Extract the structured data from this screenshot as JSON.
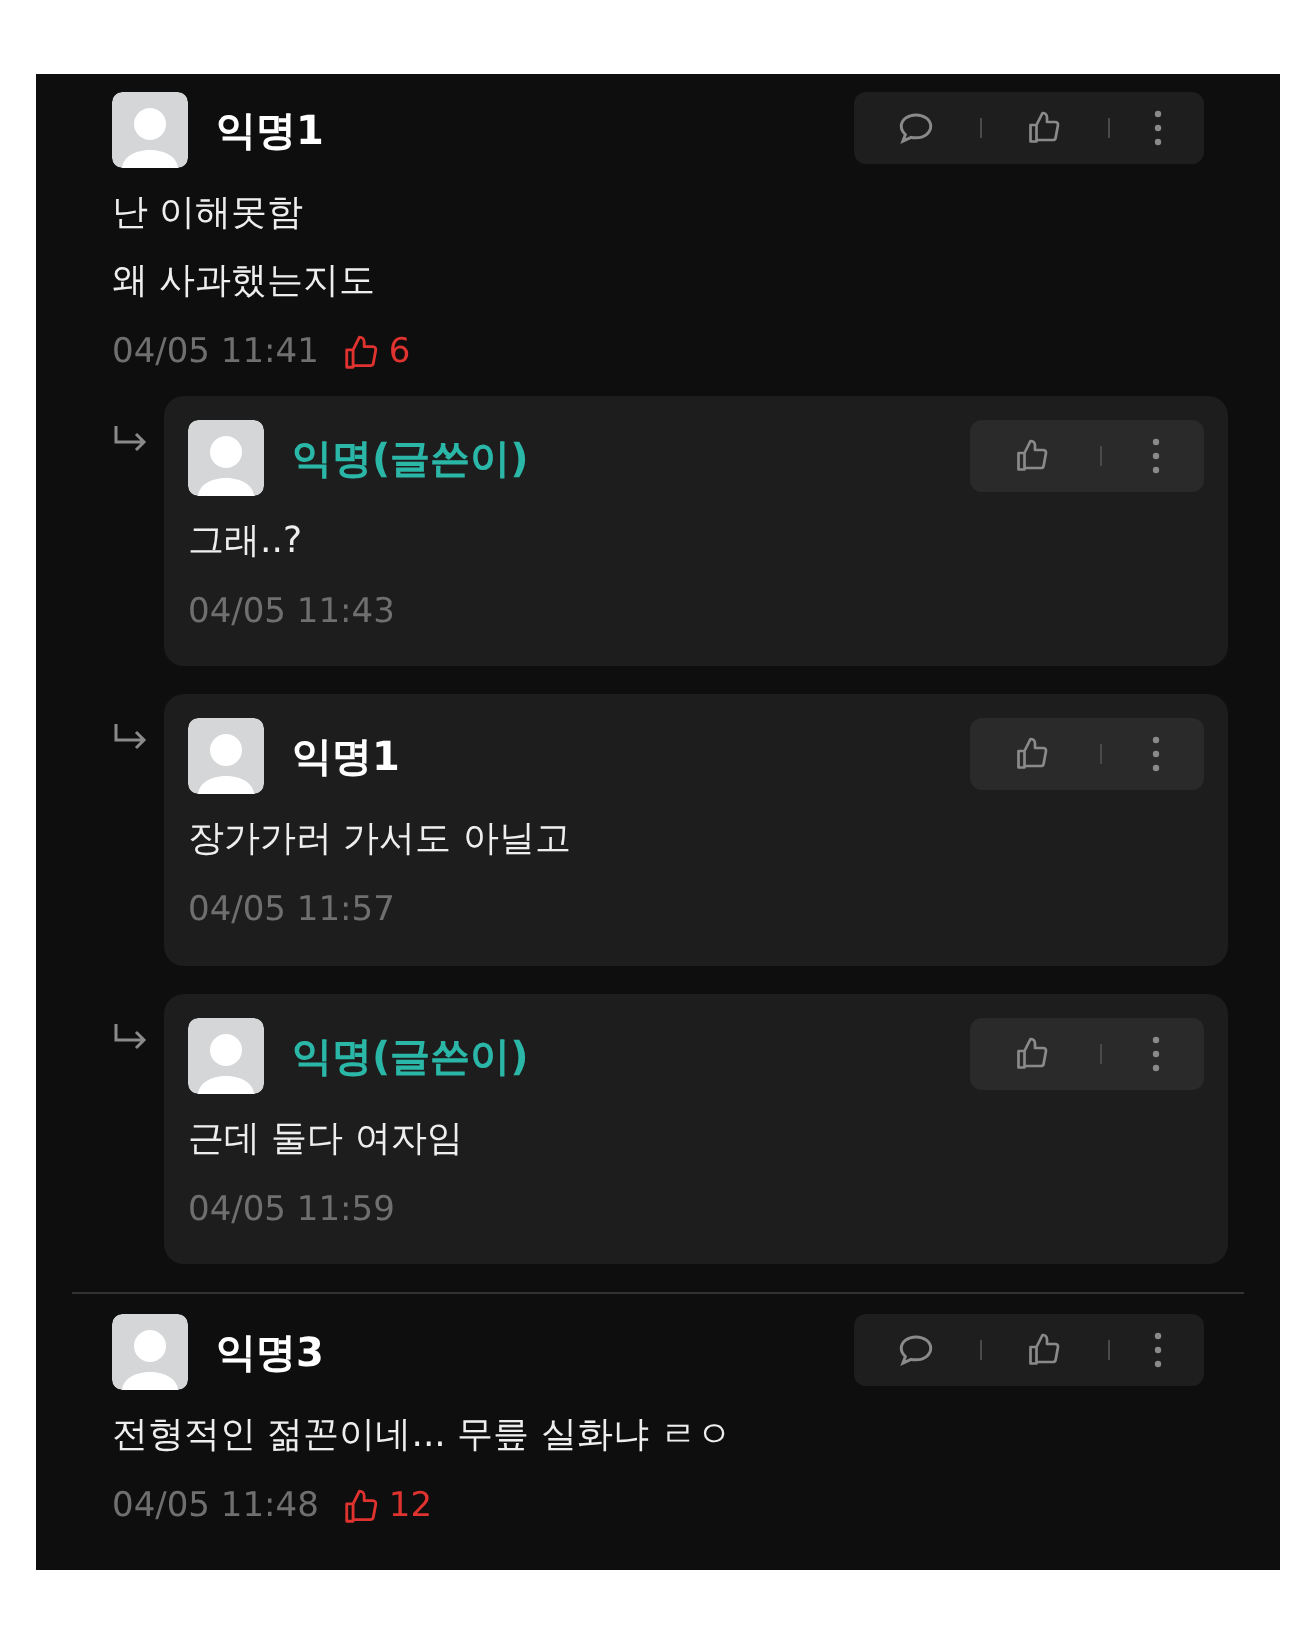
{
  "comments": [
    {
      "kind": "comment",
      "author": "익명1",
      "is_writer": false,
      "body": "난 이해못함\n왜 사과했는지도",
      "time": "04/05 11:41",
      "likes": "6",
      "children": [
        {
          "kind": "reply",
          "author": "익명(글쓴이)",
          "is_writer": true,
          "body": "그래..?",
          "time": "04/05 11:43"
        },
        {
          "kind": "reply",
          "author": "익명1",
          "is_writer": false,
          "body": "장가가러 가서도 아닐고",
          "time": "04/05 11:57"
        },
        {
          "kind": "reply",
          "author": "익명(글쓴이)",
          "is_writer": true,
          "body": "근데 둘다 여자임",
          "time": "04/05 11:59"
        }
      ]
    },
    {
      "kind": "comment",
      "author": "익명3",
      "is_writer": false,
      "body": "전형적인 젊꼰이네... 무릎 실화냐 ㄹㅇ",
      "time": "04/05 11:48",
      "likes": "12"
    }
  ]
}
